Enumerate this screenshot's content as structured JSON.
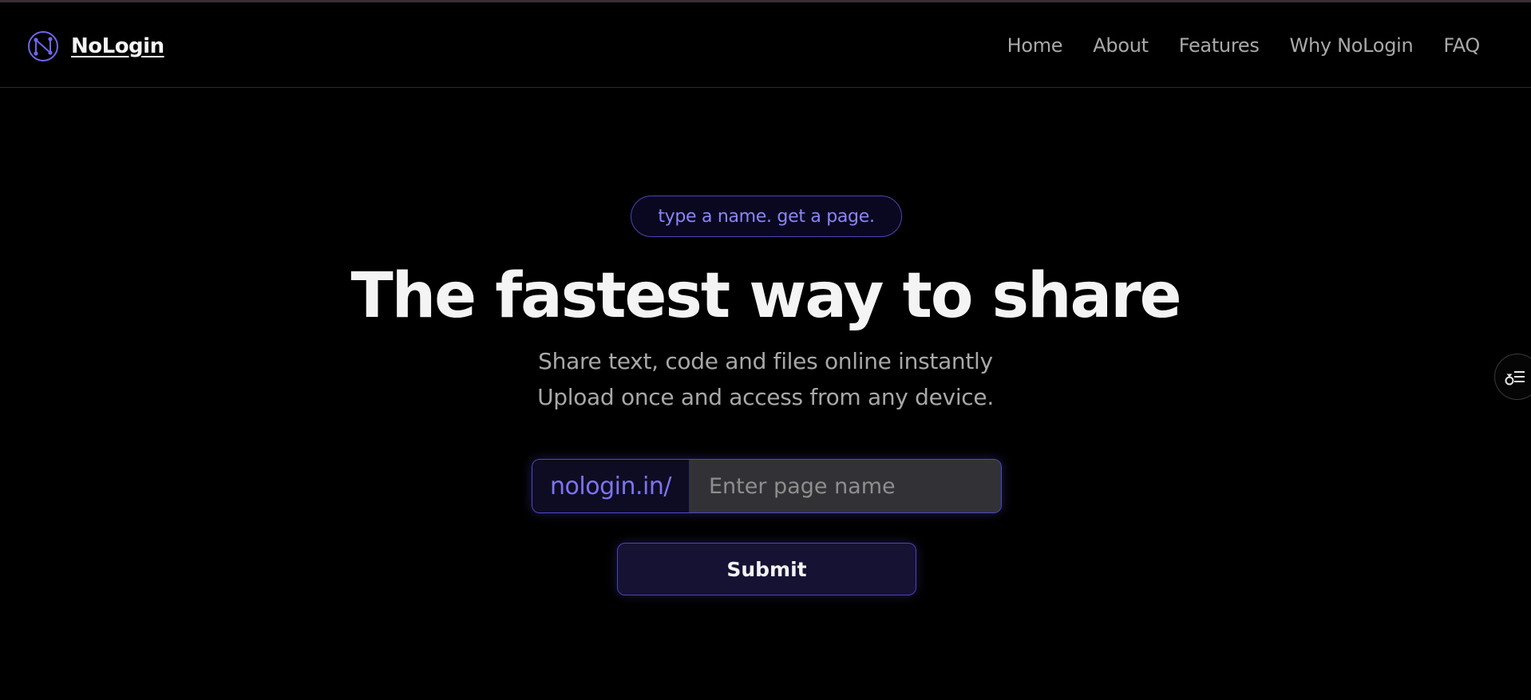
{
  "colors": {
    "background": "#000000",
    "accent": "#7d74f2",
    "accent_border": "#4f49c9",
    "nav_text": "#a9a9a9",
    "input_bg": "#323236"
  },
  "brand": {
    "name": "NoLogin",
    "logo_icon": "n-network-logo-icon"
  },
  "nav": {
    "items": [
      {
        "label": "Home"
      },
      {
        "label": "About"
      },
      {
        "label": "Features"
      },
      {
        "label": "Why NoLogin"
      },
      {
        "label": "FAQ"
      }
    ]
  },
  "hero": {
    "tagline": "type a name. get a page.",
    "title": "The fastest way to share",
    "subtitle_line1": "Share text, code and files online instantly",
    "subtitle_line2": "Upload once and access from any device."
  },
  "form": {
    "url_prefix": "nologin.in/",
    "input_placeholder": "Enter page name",
    "input_value": "",
    "submit_label": "Submit"
  },
  "side_widget": {
    "icon": "filter-list-icon"
  }
}
